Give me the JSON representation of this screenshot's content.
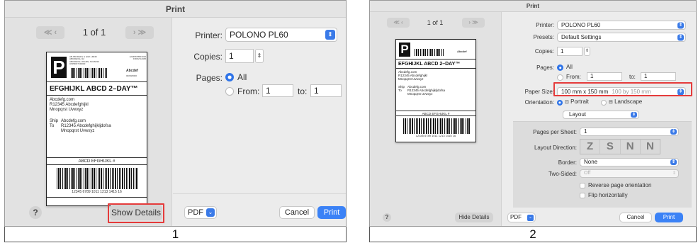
{
  "captions": {
    "first": "1",
    "second": "2"
  },
  "dialog_title": "Print",
  "preview": {
    "page_count": "1 of 1",
    "nav_prev": "≪ ‹",
    "nav_next": "› ≫"
  },
  "label": {
    "carrier_letter": "P",
    "service": "EFGHIJKL ABCD 2–DAY™",
    "from_lines": [
      "Abcdefg.com",
      "R12345 Abcdefghijkl",
      "Mnopqrst Uvwxyz"
    ],
    "ship_to_label": "Ship\nTo",
    "ship_to_lines": [
      "Abcdefg.com",
      "R12345 Abcdefghijkljdofsa",
      "Mnopqrst Uvwxyz"
    ],
    "tracking_title": "ABCD EFGHIJKL #",
    "tracking_number": "12345 6789 1011 1213 1415 16",
    "header_small_left": "AB ABCDEFG & HIJK LMNO\nABCDEFGH 12\nABCDEFGH.JKLMN, NOJMNO\nUSPRINT 00000",
    "header_small_right": "12345678901010\nFROM 12345",
    "header_badge": "Abcdef",
    "header_date": "00/00/0000"
  },
  "panel1": {
    "printer_label": "Printer:",
    "printer_value": "POLONO PL60",
    "copies_label": "Copies:",
    "copies_value": "1",
    "pages_label": "Pages:",
    "pages_all": "All",
    "pages_from": "From:",
    "from_value": "1",
    "to_label": "to:",
    "to_value": "1",
    "show_details": "Show Details",
    "pdf": "PDF",
    "cancel": "Cancel",
    "print": "Print",
    "help": "?"
  },
  "panel2": {
    "printer_label": "Printer:",
    "printer_value": "POLONO PL60",
    "presets_label": "Presets:",
    "presets_value": "Default Settings",
    "copies_label": "Copies:",
    "copies_value": "1",
    "pages_label": "Pages:",
    "pages_all": "All",
    "pages_from": "From:",
    "from_value": "1",
    "to_label": "to:",
    "to_value": "1",
    "paper_size_label": "Paper Size:",
    "paper_size_value": "100 mm x 150 mm",
    "paper_size_hint": "100 by 150 mm",
    "orientation_label": "Orientation:",
    "portrait": "Portrait",
    "landscape": "Landscape",
    "section_value": "Layout",
    "pages_per_sheet_label": "Pages per Sheet:",
    "pages_per_sheet_value": "1",
    "layout_direction_label": "Layout Direction:",
    "layout_direction_icons": [
      "Z",
      "S",
      "N",
      "N"
    ],
    "border_label": "Border:",
    "border_value": "None",
    "two_sided_label": "Two-Sided:",
    "two_sided_value": "Off",
    "reverse_orientation": "Reverse page orientation",
    "flip_horizontally": "Flip horizontally",
    "hide_details": "Hide Details",
    "pdf": "PDF",
    "cancel": "Cancel",
    "print": "Print",
    "help": "?"
  },
  "colors": {
    "accent": "#3b82f6",
    "highlight": "#e53b3b"
  }
}
